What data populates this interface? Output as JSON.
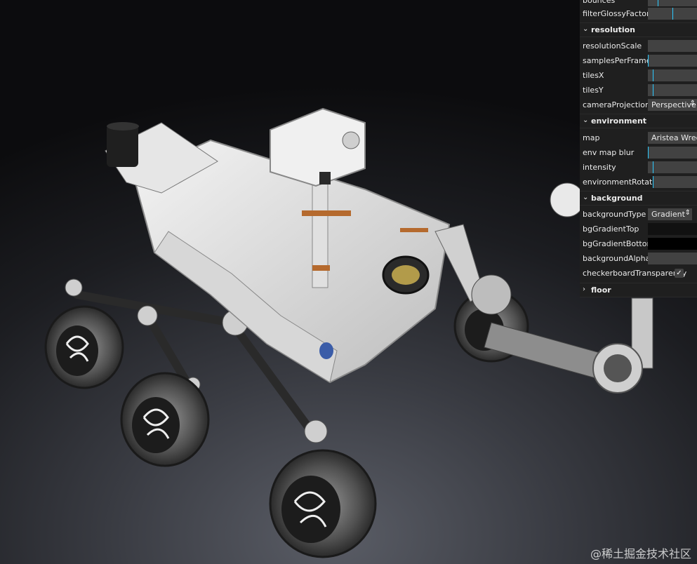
{
  "gui": {
    "rows_top": [
      {
        "label": "bounces",
        "value": 0.05
      },
      {
        "label": "filterGlossyFactor",
        "value": 0.5
      }
    ],
    "resolution": {
      "title": "resolution",
      "rows": [
        {
          "label": "resolutionScale",
          "value": 0.0
        },
        {
          "label": "samplesPerFrame",
          "value": 0.0
        },
        {
          "label": "tilesX",
          "value": 0.1
        },
        {
          "label": "tilesY",
          "value": 0.1
        }
      ],
      "camera_label": "cameraProjection",
      "camera_value": "Perspective"
    },
    "environment": {
      "title": "environment",
      "map_label": "map",
      "map_value": "Aristea Wreck",
      "rows": [
        {
          "label": "env map blur",
          "value": 0.0
        },
        {
          "label": "intensity",
          "value": 0.1
        },
        {
          "label": "environmentRotation",
          "value": 0.0
        }
      ]
    },
    "background": {
      "title": "background",
      "type_label": "backgroundType",
      "type_value": "Gradient",
      "top_label": "bgGradientTop",
      "top_color": "#111111",
      "bottom_label": "bgGradientBottom",
      "bottom_color": "#000000",
      "alpha_label": "backgroundAlpha",
      "checker_label": "checkerboardTransparency",
      "checker_checked": true
    },
    "floor": {
      "title": "floor"
    }
  },
  "accent_color": "#2cc9ff",
  "watermark": "@稀土掘金技术社区"
}
